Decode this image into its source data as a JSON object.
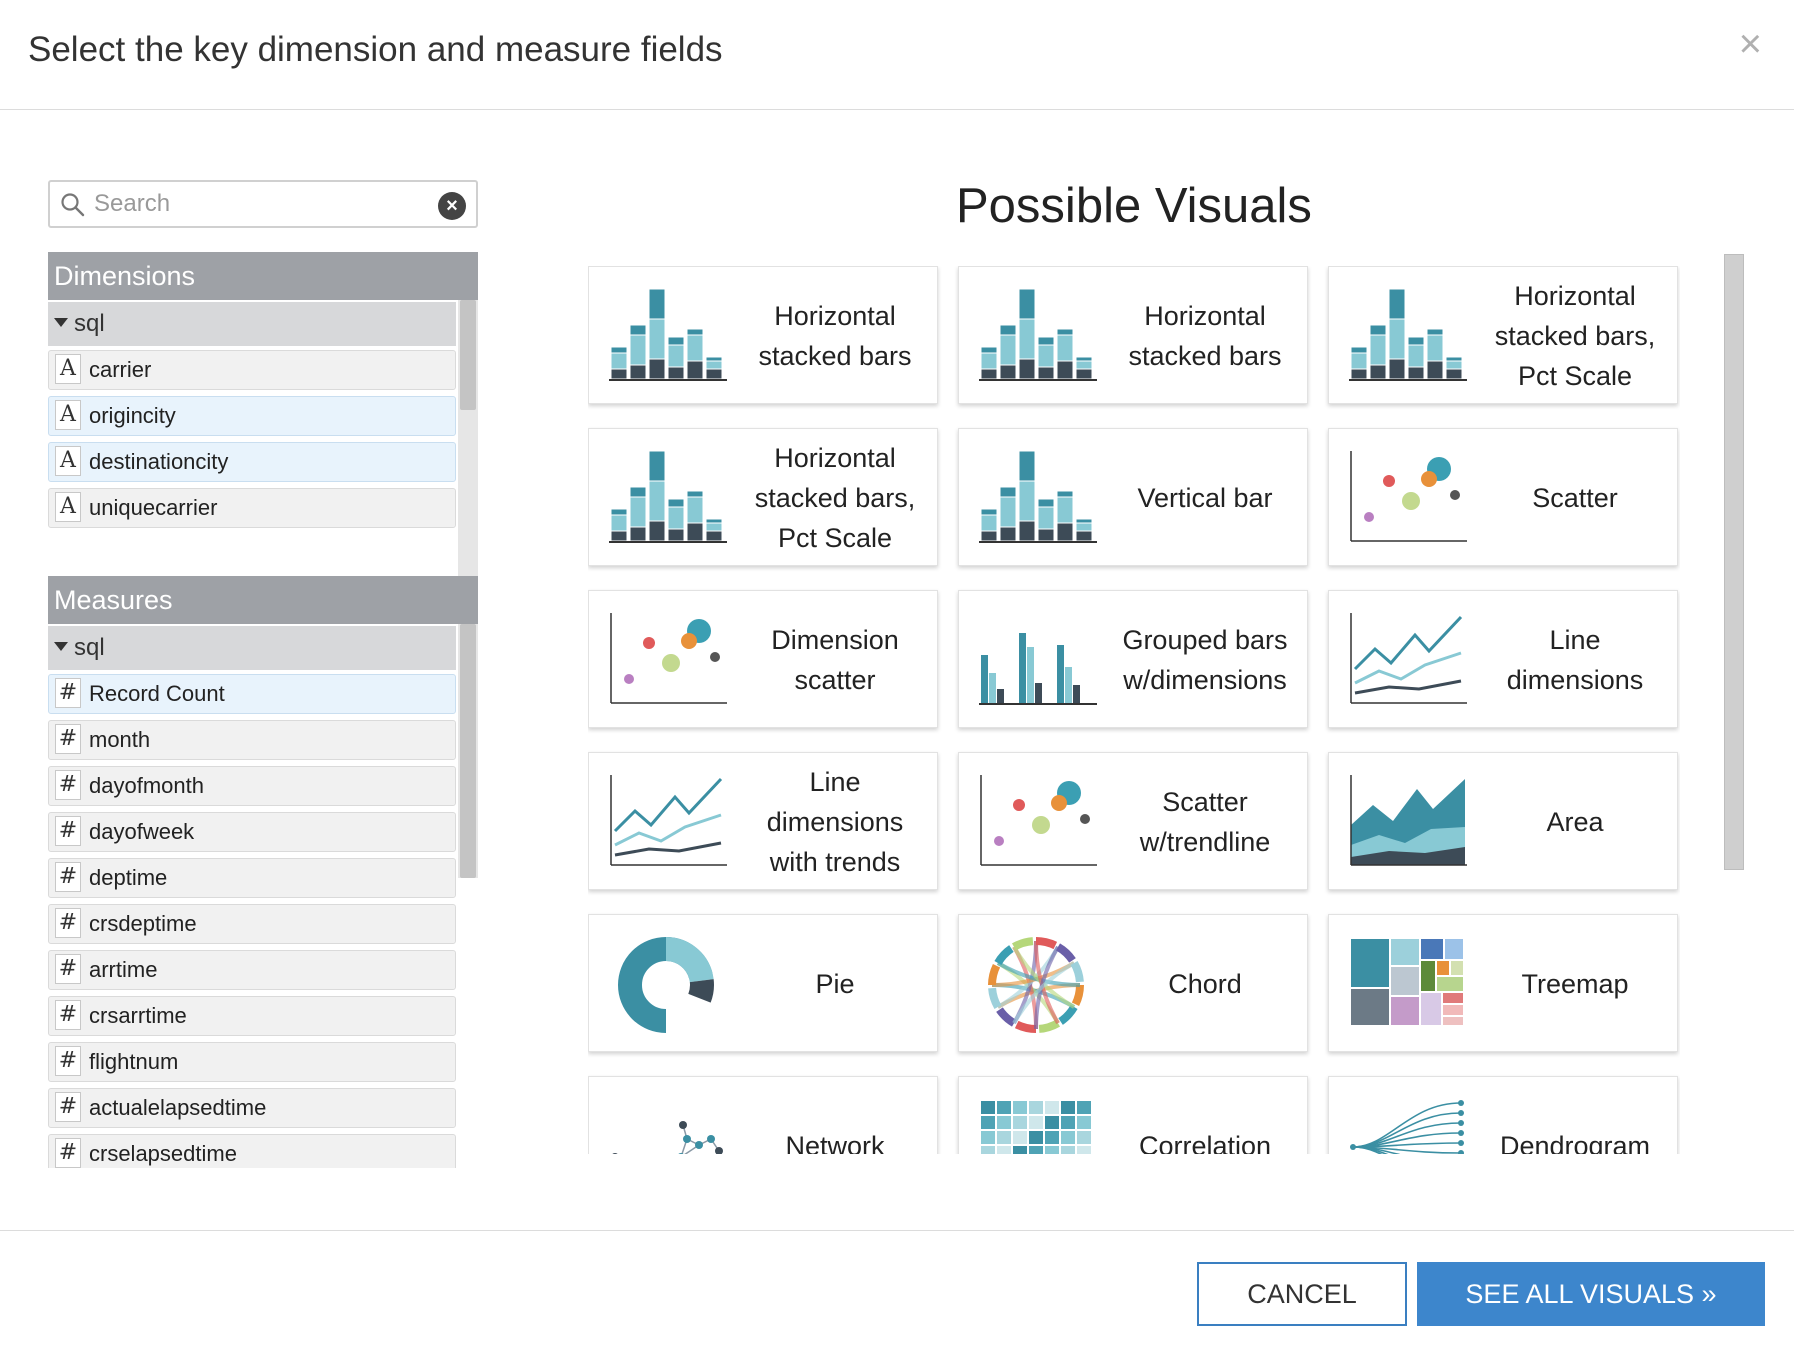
{
  "dialog": {
    "title": "Select the key dimension and measure fields",
    "close_glyph": "×"
  },
  "search": {
    "placeholder": "Search",
    "value": ""
  },
  "dimensions": {
    "header": "Dimensions",
    "group": "sql",
    "items": [
      {
        "type": "A",
        "label": "carrier",
        "selected": false
      },
      {
        "type": "A",
        "label": "origincity",
        "selected": true
      },
      {
        "type": "A",
        "label": "destinationcity",
        "selected": true
      },
      {
        "type": "A",
        "label": "uniquecarrier",
        "selected": false
      }
    ]
  },
  "measures": {
    "header": "Measures",
    "group": "sql",
    "items": [
      {
        "type": "#",
        "label": "Record Count",
        "selected": true
      },
      {
        "type": "#",
        "label": "month",
        "selected": false
      },
      {
        "type": "#",
        "label": "dayofmonth",
        "selected": false
      },
      {
        "type": "#",
        "label": "dayofweek",
        "selected": false
      },
      {
        "type": "#",
        "label": "deptime",
        "selected": false
      },
      {
        "type": "#",
        "label": "crsdeptime",
        "selected": false
      },
      {
        "type": "#",
        "label": "arrtime",
        "selected": false
      },
      {
        "type": "#",
        "label": "crsarrtime",
        "selected": false
      },
      {
        "type": "#",
        "label": "flightnum",
        "selected": false
      },
      {
        "type": "#",
        "label": "actualelapsedtime",
        "selected": false
      },
      {
        "type": "#",
        "label": "crselapsedtime",
        "selected": false
      }
    ]
  },
  "visuals": {
    "title": "Possible Visuals",
    "cards": [
      {
        "label": "Horizontal stacked bars",
        "icon": "stacked-bars-icon"
      },
      {
        "label": "Horizontal stacked bars",
        "icon": "stacked-bars-icon"
      },
      {
        "label": "Horizontal stacked bars, Pct Scale",
        "icon": "stacked-bars-icon"
      },
      {
        "label": "Horizontal stacked bars, Pct Scale",
        "icon": "stacked-bars-icon"
      },
      {
        "label": "Vertical bar",
        "icon": "stacked-bars-icon"
      },
      {
        "label": "Scatter",
        "icon": "scatter-icon"
      },
      {
        "label": "Dimension scatter",
        "icon": "scatter-icon"
      },
      {
        "label": "Grouped bars w/dimensions",
        "icon": "grouped-bars-icon"
      },
      {
        "label": "Line dimensions",
        "icon": "line-icon"
      },
      {
        "label": "Line dimensions with trends",
        "icon": "line-icon"
      },
      {
        "label": "Scatter w/trendline",
        "icon": "scatter-icon"
      },
      {
        "label": "Area",
        "icon": "area-icon"
      },
      {
        "label": "Pie",
        "icon": "pie-icon"
      },
      {
        "label": "Chord",
        "icon": "chord-icon"
      },
      {
        "label": "Treemap",
        "icon": "treemap-icon"
      },
      {
        "label": "Network",
        "icon": "network-icon"
      },
      {
        "label": "Correlation",
        "icon": "heatmap-icon"
      },
      {
        "label": "Dendrogram",
        "icon": "dendrogram-icon"
      }
    ]
  },
  "footer": {
    "cancel_label": "CANCEL",
    "see_all_label": "SEE ALL VISUALS »"
  },
  "colors": {
    "primary": "#3d86cc",
    "teal_dark": "#3b8fa3",
    "teal_light": "#88c9d4",
    "slate": "#3d4b57",
    "section_header": "#9ea1a6"
  }
}
